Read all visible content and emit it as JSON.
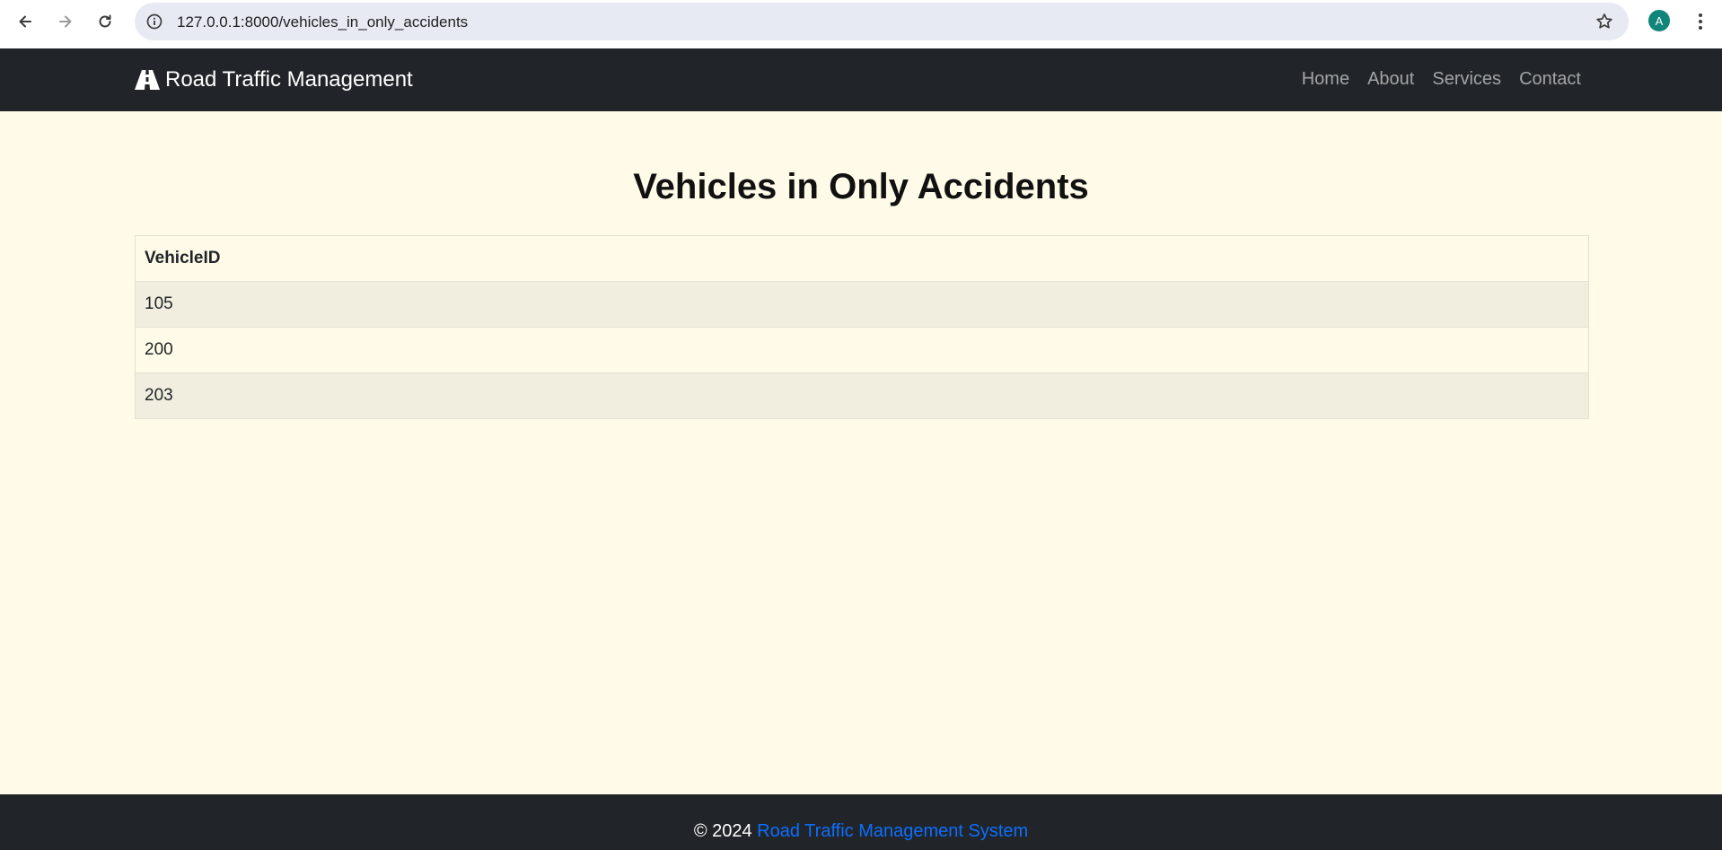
{
  "browser": {
    "url": "127.0.0.1:8000/vehicles_in_only_accidents",
    "profile_initial": "A",
    "icons": [
      "back-arrow-icon",
      "forward-arrow-icon",
      "reload-icon",
      "site-info-icon",
      "bookmark-star-icon",
      "more-menu-icon"
    ]
  },
  "navbar": {
    "brand": "Road Traffic Management",
    "brand_icon": "road-icon",
    "links": [
      "Home",
      "About",
      "Services",
      "Contact"
    ]
  },
  "main": {
    "title": "Vehicles in Only Accidents",
    "table": {
      "columns": [
        "VehicleID"
      ],
      "rows": [
        [
          "105"
        ],
        [
          "200"
        ],
        [
          "203"
        ]
      ]
    }
  },
  "footer": {
    "prefix": "© 2024",
    "link": "Road Traffic Management System"
  },
  "colors": {
    "navbar_bg": "#212529",
    "page_bg": "#fffbe8",
    "stripe_bg": "#f1eedf",
    "footer_link": "#0d6efd"
  }
}
